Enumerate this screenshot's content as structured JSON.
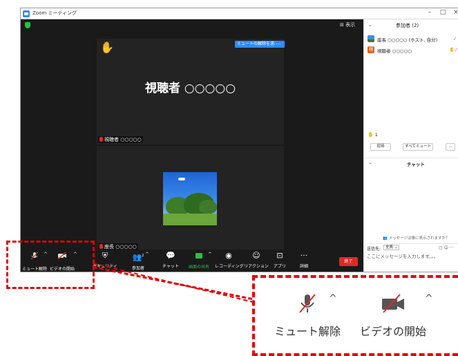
{
  "window": {
    "title": "Zoom ミーティング",
    "controls": {
      "minimize": "–",
      "maximize": "□",
      "close": "×"
    }
  },
  "video": {
    "view_label": "表示",
    "tile1": {
      "unmute_request": "ミュートの解除を求める",
      "more": "…",
      "display_name": "視聴者 ○○○○○",
      "label": "視聴者 ○○○○○"
    },
    "tile2": {
      "label": "座長 ○○○○○"
    }
  },
  "toolbar": {
    "unmute": {
      "icon": "mic-muted-icon",
      "label": "ミュート解除"
    },
    "video": {
      "icon": "video-off-icon",
      "label": "ビデオの開始"
    },
    "security": {
      "icon": "shield-icon",
      "label": "セキュリティ"
    },
    "participants": {
      "icon": "people-icon",
      "label": "参加者",
      "count": "2"
    },
    "chat": {
      "icon": "chat-icon",
      "label": "チャット"
    },
    "share": {
      "icon": "share-screen-icon",
      "label": "画面の共有"
    },
    "record": {
      "icon": "record-icon",
      "label": "レコーディング"
    },
    "reactions": {
      "icon": "reaction-icon",
      "label": "リアクション"
    },
    "apps": {
      "icon": "apps-icon",
      "label": "アプリ"
    },
    "more": {
      "icon": "more-icon",
      "label": "詳細"
    },
    "end": "終了"
  },
  "panel": {
    "title": "参加者 (2)",
    "participants": [
      {
        "name": "座長 ○○○○○ (ホスト, 自分)",
        "avatar": "photo"
      },
      {
        "name": "視聴者 ○○○○○",
        "avatar_initial": "視",
        "hand_raised": true
      }
    ],
    "raised_count": "1",
    "invite": "招待",
    "mute_all": "すべてミュート",
    "more": "…",
    "chat_title": "チャット",
    "who_notice": "メッセージは誰に表示されますか？",
    "send_to_label": "送信先:",
    "send_to_value": "全員 ⌄",
    "input_placeholder": "ここにメッセージを入力します。。。"
  },
  "zoomed": {
    "unmute_label": "ミュート解除",
    "video_label": "ビデオの開始"
  },
  "colors": {
    "zoom_blue": "#2d8cff",
    "mute_red": "#e02828",
    "share_green": "#23c341",
    "highlight_red": "#e00000"
  }
}
